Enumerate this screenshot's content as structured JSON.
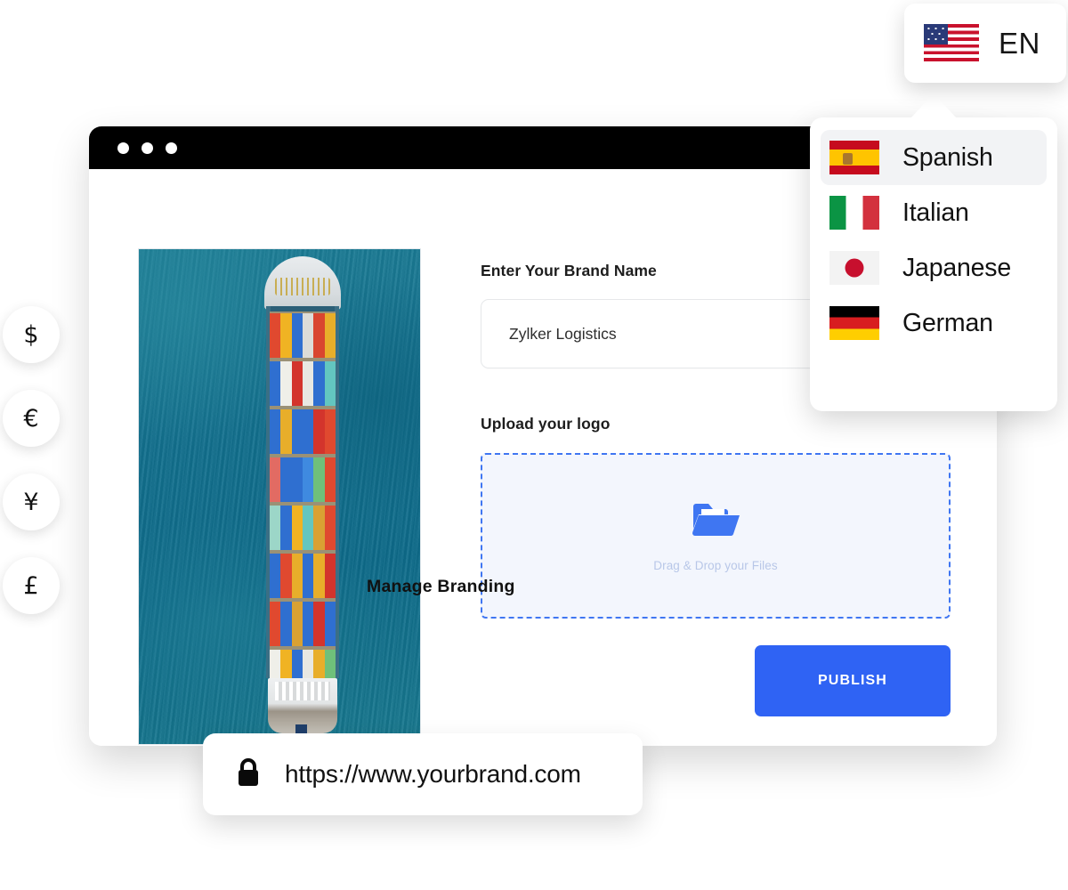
{
  "window": {
    "titlebar_dots": 3
  },
  "photo": {
    "alt": "aerial view of a loaded container ship at sea"
  },
  "form": {
    "brand_label": "Enter Your Brand Name",
    "brand_value": "Zylker Logistics",
    "brand_placeholder": "Enter Your Brand Name",
    "upload_label": "Upload your logo",
    "dropzone_text": "Drag & Drop your Files",
    "dropzone_icon": "open-folder-icon",
    "publish_label": "PUBLISH"
  },
  "caption": {
    "manage_branding": "Manage Branding"
  },
  "url_bar": {
    "lock_icon": "lock-icon",
    "url": "https://www.yourbrand.com"
  },
  "currencies": [
    {
      "symbol": "$",
      "name": "dollar"
    },
    {
      "symbol": "€",
      "name": "euro"
    },
    {
      "symbol": "¥",
      "name": "yen"
    },
    {
      "symbol": "£",
      "name": "pound"
    }
  ],
  "language_button": {
    "flag": "flag-us",
    "code": "EN"
  },
  "language_dropdown": {
    "items": [
      {
        "label": "Spanish",
        "flag": "flag-es",
        "selected": true
      },
      {
        "label": "Italian",
        "flag": "flag-it",
        "selected": false
      },
      {
        "label": "Japanese",
        "flag": "flag-jp",
        "selected": false
      },
      {
        "label": "German",
        "flag": "flag-de",
        "selected": false
      }
    ]
  },
  "colors": {
    "accent_blue": "#2f63f4",
    "dropzone_border": "#3f76f2",
    "dropzone_bg": "#f3f6fd",
    "titlebar": "#000000",
    "selected_row": "#f2f3f5"
  }
}
